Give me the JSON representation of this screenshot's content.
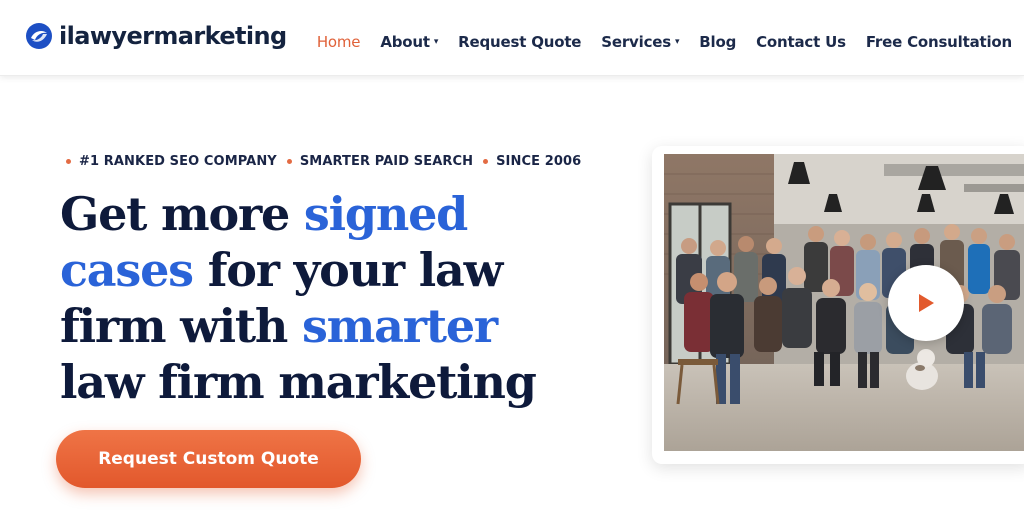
{
  "header": {
    "logo_text": "ilawyermarketing",
    "nav": {
      "home": "Home",
      "about": "About",
      "request_quote": "Request Quote",
      "services": "Services",
      "blog": "Blog",
      "contact": "Contact Us",
      "free_consultation": "Free Consultation"
    },
    "caret_glyph": "▾"
  },
  "hero": {
    "tagline": [
      "#1 RANKED SEO COMPANY",
      "SMARTER PAID SEARCH",
      "SINCE 2006"
    ],
    "headline": {
      "p1": "Get more ",
      "a1": "signed",
      "p2": " ",
      "a2": "cases",
      "p3": " for your law firm with ",
      "a3": "smarter",
      "p4": " law firm marketing"
    },
    "cta_label": "Request Custom Quote"
  },
  "video": {
    "icon": "play-icon"
  },
  "colors": {
    "brand_navy": "#0e1a3b",
    "accent_blue": "#2a63d8",
    "accent_orange": "#e25a2d"
  }
}
